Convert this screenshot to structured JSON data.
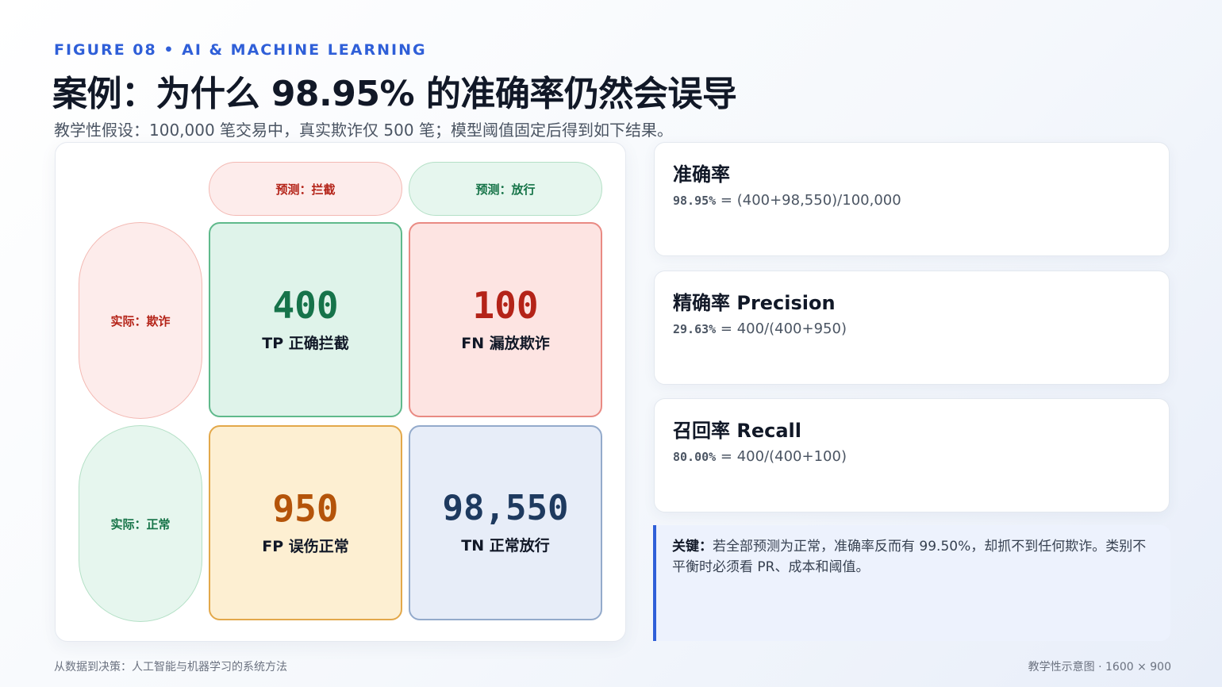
{
  "header": {
    "eyebrow": "FIGURE 08 • AI & MACHINE LEARNING",
    "title": "案例：为什么 98.95% 的准确率仍然会误导",
    "subtitle": "教学性假设：100,000 笔交易中，真实欺诈仅 500 笔；模型阈值固定后得到如下结果。"
  },
  "matrix": {
    "col_headers": [
      "预测：拦截",
      "预测：放行"
    ],
    "row_headers": [
      "实际：欺诈",
      "实际：正常"
    ],
    "cells": {
      "tp": {
        "value": "400",
        "label": "TP 正确拦截"
      },
      "fn": {
        "value": "100",
        "label": "FN 漏放欺诈"
      },
      "fp": {
        "value": "950",
        "label": "FP 误伤正常"
      },
      "tn": {
        "value": "98,550",
        "label": "TN 正常放行"
      }
    }
  },
  "metrics": [
    {
      "name": "准确率",
      "value": "98.95%",
      "formula": " = (400+98,550)/100,000"
    },
    {
      "name": "精确率 Precision",
      "value": "29.63%",
      "formula": " = 400/(400+950)"
    },
    {
      "name": "召回率 Recall",
      "value": "80.00%",
      "formula": " = 400/(400+100)"
    }
  ],
  "note": {
    "key": "关键：",
    "text": "若全部预测为正常，准确率反而有 99.50%，却抓不到任何欺诈。类别不平衡时必须看 PR、成本和阈值。"
  },
  "footer": {
    "left": "从数据到决策：人工智能与机器学习的系统方法",
    "right": "教学性示意图 · 1600 × 900"
  },
  "colors": {
    "accent": "#2f5fd8",
    "tp": "#16734a",
    "fn": "#b42318",
    "fp": "#b4540a",
    "tn": "#1e3a5f"
  }
}
